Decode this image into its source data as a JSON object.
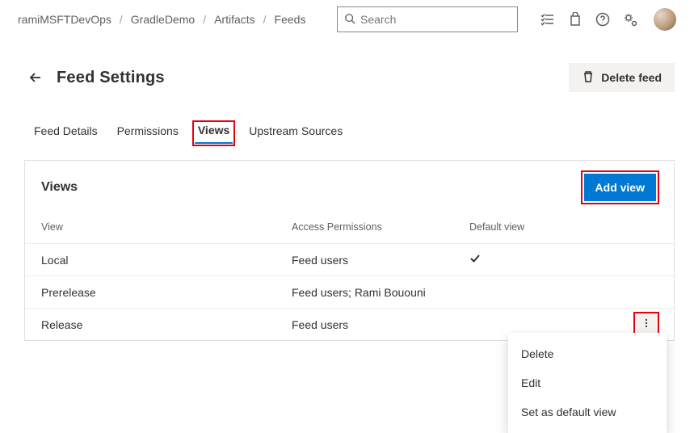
{
  "breadcrumbs": [
    "ramiMSFTDevOps",
    "GradleDemo",
    "Artifacts",
    "Feeds"
  ],
  "search": {
    "placeholder": "Search"
  },
  "page": {
    "title": "Feed Settings",
    "delete_label": "Delete feed"
  },
  "tabs": [
    {
      "label": "Feed Details",
      "active": false
    },
    {
      "label": "Permissions",
      "active": false
    },
    {
      "label": "Views",
      "active": true
    },
    {
      "label": "Upstream Sources",
      "active": false
    }
  ],
  "panel": {
    "title": "Views",
    "add_label": "Add view",
    "columns": {
      "c1": "View",
      "c2": "Access Permissions",
      "c3": "Default view"
    },
    "rows": [
      {
        "view": "Local",
        "access": "Feed users",
        "is_default": true
      },
      {
        "view": "Prerelease",
        "access": "Feed users; Rami Bououni",
        "is_default": false
      },
      {
        "view": "Release",
        "access": "Feed users",
        "is_default": false,
        "show_action": true
      }
    ]
  },
  "menu": {
    "items": [
      "Delete",
      "Edit",
      "Set as default view"
    ]
  }
}
